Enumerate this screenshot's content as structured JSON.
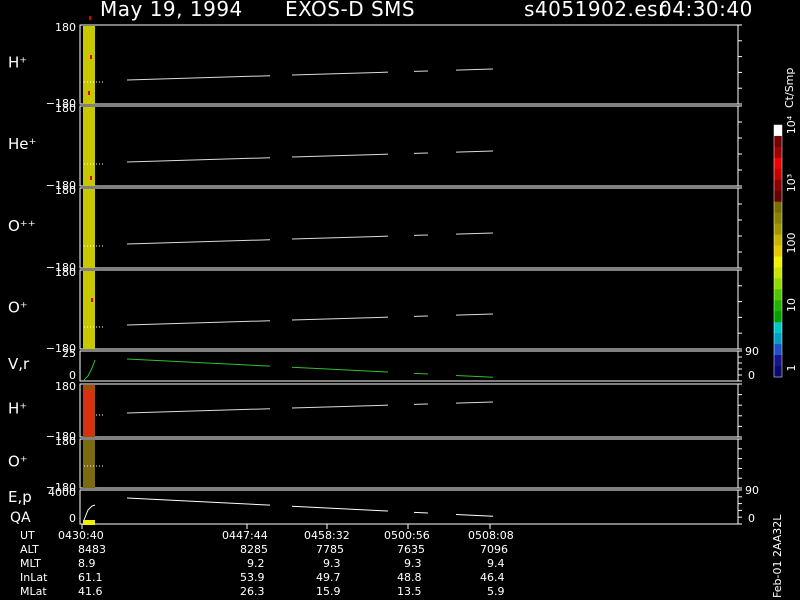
{
  "header": {
    "date": "May 19, 1994",
    "instrument": "EXOS-D SMS",
    "file": "s4051902.esr",
    "time": "04:30:40"
  },
  "colorbar": {
    "unit": "Ct/Smp",
    "ticks": [
      "1",
      "10",
      "100",
      "10³",
      "10⁴"
    ],
    "colors": [
      "#0a0a6e",
      "#14148c",
      "#1e50c8",
      "#00a0c8",
      "#00c8c8",
      "#00a000",
      "#20b400",
      "#50c800",
      "#90dc00",
      "#c8e600",
      "#f0f000",
      "#e6c800",
      "#c8b400",
      "#a09600",
      "#8c8000",
      "#786e00",
      "#640000",
      "#8c0000",
      "#c80000",
      "#f00000",
      "#a00000",
      "#780000",
      "#ffffff"
    ]
  },
  "panels": [
    {
      "label": "H⁺",
      "ymax": "180",
      "ymin": "−180",
      "fill": "#c8c800"
    },
    {
      "label": "He⁺",
      "ymax": "180",
      "ymin": "−180",
      "fill": "#c8c800"
    },
    {
      "label": "O⁺⁺",
      "ymax": "180",
      "ymin": "−180",
      "fill": "#c8c800"
    },
    {
      "label": "O⁺",
      "ymax": "180",
      "ymin": "−180",
      "fill": "#c8c800"
    },
    {
      "label": "V,r",
      "ymax": "25",
      "ymin": "0",
      "right_top": "90",
      "right_bottom": "0"
    },
    {
      "label": "H⁺",
      "ymax": "180",
      "ymin": "−180",
      "fill": "#a05000"
    },
    {
      "label": "O⁺",
      "ymax": "180",
      "ymin": "−180",
      "fill": "#7a6a10"
    },
    {
      "label": "E,p",
      "label2": "QA",
      "ymax": "4000",
      "ymin": "0",
      "right_top": "90",
      "right_bottom": "0"
    }
  ],
  "footer": {
    "rows": [
      {
        "name": "UT",
        "values": [
          "0430:40",
          "0447:44",
          "0458:32",
          "0500:56",
          "0508:08"
        ]
      },
      {
        "name": "ALT",
        "values": [
          "8483",
          "8285",
          "7785",
          "7635",
          "7096"
        ]
      },
      {
        "name": "MLT",
        "values": [
          "8.9",
          "9.2",
          "9.3",
          "9.3",
          "9.4"
        ]
      },
      {
        "name": "InLat",
        "values": [
          "61.1",
          "53.9",
          "49.7",
          "48.8",
          "46.4"
        ]
      },
      {
        "name": "MLat",
        "values": [
          "41.6",
          "26.3",
          "15.9",
          "13.5",
          "5.9"
        ]
      }
    ],
    "version": "Feb-01 2AA32L"
  },
  "chart_data": {
    "type": "heatmap",
    "title": "May 19, 1994   EXOS-D SMS",
    "x_ticks": [
      "0430:40",
      "0447:44",
      "0458:32",
      "0500:56",
      "0508:08"
    ],
    "segments": [
      {
        "from": "0430:40",
        "to": "0447:44",
        "present": true
      },
      {
        "from": "0458:32",
        "to": "0500:56",
        "present": true
      },
      {
        "from": "0500:56",
        "to": "0508:08",
        "present": true
      }
    ],
    "ylim_angle": [
      -180,
      180
    ],
    "ylim_velocity": [
      0,
      25
    ],
    "ylim_energy": [
      0,
      4000
    ],
    "colorbar_unit": "Ct/Smp",
    "colorbar_range": [
      1,
      10000
    ],
    "log_colorbar": true
  }
}
